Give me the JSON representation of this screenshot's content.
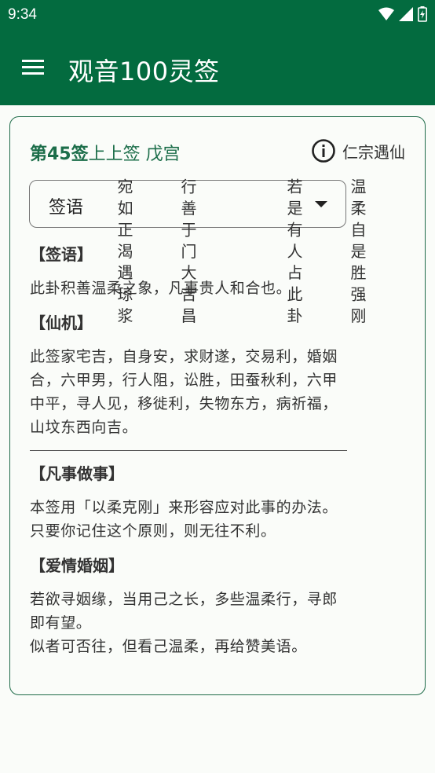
{
  "status_bar": {
    "time": "9:34"
  },
  "app_bar": {
    "title": "观音100灵签"
  },
  "card": {
    "title_prefix": "第45签",
    "title_rank": "上上签 戊宫",
    "deity": "仁宗遇仙",
    "dropdown": {
      "selected": "签语"
    },
    "sections": [
      {
        "head": "【签语】",
        "body": "此卦积善温柔之象，凡事贵人和合也。"
      },
      {
        "head": "【仙机】",
        "body": "此签家宅吉，自身安，求财遂，交易利，婚姻合，六甲男，行人阻，讼胜，田蚕秋利，六甲中平，寻人见，移徙利，失物东方，病祈福， 山坟东西向吉。"
      },
      {
        "head": "【凡事做事】",
        "body": "本签用「以柔克刚」来形容应对此事的办法。\n只要你记住这个原则，则无往不利。"
      },
      {
        "head": "【爱情婚姻】",
        "body": "若欲寻姻缘，当用己之长，多些温柔行，寻郎即有望。\n似者可否往，但看己温柔，再给赞美语。"
      }
    ],
    "poem_columns": [
      "温柔自是胜强刚",
      "若是有人占此卦",
      "",
      "行善于门大吉昌",
      "宛如正渴遇琼浆"
    ]
  }
}
